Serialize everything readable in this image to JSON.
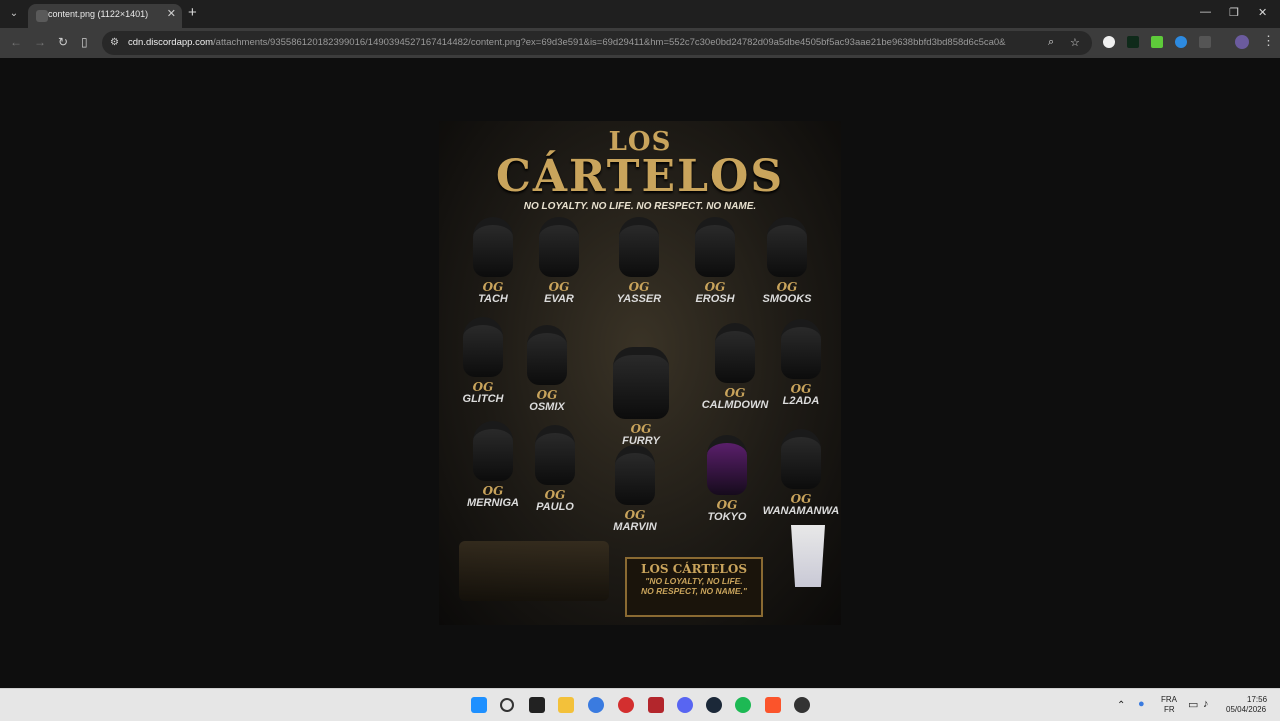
{
  "browser": {
    "tab_title": "content.png (1122×1401)",
    "tab_close": "✕",
    "new_tab": "+",
    "window_controls": {
      "minimize": "—",
      "restore": "❐",
      "close": "✕"
    },
    "url_host": "cdn.discordapp.com",
    "url_path": "/attachments/935586120182399016/1490394527167414482/content.png?ex=69d3e591&is=69d29411&hm=552c7c30e0bd24782d09a5dbe4505bf5ac93aae21be9638bbfd3bd858d6c5ca0&"
  },
  "poster": {
    "title_top": "LOS",
    "title_main": "CÁRTELOS",
    "tagline": "NO LOYALTY. NO LIFE. NO RESPECT. NO NAME.",
    "og_label": "OG",
    "members": [
      "TACH",
      "EVAR",
      "YASSER",
      "EROSH",
      "SMOOKS",
      "GLITCH",
      "OSMIX",
      "FURRY",
      "CALMDOWN",
      "L2ADA",
      "MERNIGA",
      "PAULO",
      "MARVIN",
      "TOKYO",
      "WANAMANWA"
    ],
    "plaque_title": "LOS CÁRTELOS",
    "plaque_line1": "\"NO LOYALTY, NO LIFE.",
    "plaque_line2": "NO RESPECT, NO NAME.\""
  },
  "taskbar": {
    "language": "FRA",
    "language_sub": "FR",
    "time": "17:56",
    "date": "05/04/2026"
  },
  "colors": {
    "accent_gold": "#c9a45c",
    "browser_dark": "#3c3c3c",
    "page_bg": "#0e0e0e",
    "taskbar_bg": "#e6e6e6"
  }
}
